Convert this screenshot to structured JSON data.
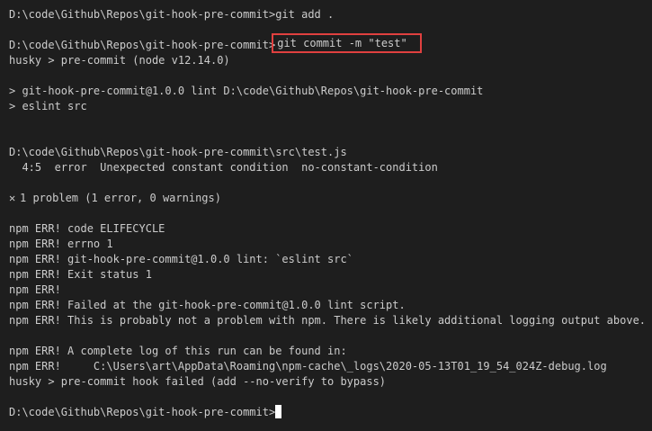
{
  "terminal": {
    "lines": [
      {
        "text": "D:\\code\\Github\\Repos\\git-hook-pre-commit>git add ."
      },
      {
        "text": ""
      },
      {
        "prompt": "D:\\code\\Github\\Repos\\git-hook-pre-commit>",
        "command": "git commit -m \"test\""
      },
      {
        "text": "husky > pre-commit (node v12.14.0)"
      },
      {
        "text": ""
      },
      {
        "text": "> git-hook-pre-commit@1.0.0 lint D:\\code\\Github\\Repos\\git-hook-pre-commit"
      },
      {
        "text": "> eslint src"
      },
      {
        "text": ""
      },
      {
        "text": ""
      },
      {
        "text": "D:\\code\\Github\\Repos\\git-hook-pre-commit\\src\\test.js"
      },
      {
        "text": "  4:5  error  Unexpected constant condition  no-constant-condition"
      },
      {
        "text": ""
      },
      {
        "icon": "✕",
        "text": "1 problem (1 error, 0 warnings)"
      },
      {
        "text": ""
      },
      {
        "text": "npm ERR! code ELIFECYCLE"
      },
      {
        "text": "npm ERR! errno 1"
      },
      {
        "text": "npm ERR! git-hook-pre-commit@1.0.0 lint: `eslint src`"
      },
      {
        "text": "npm ERR! Exit status 1"
      },
      {
        "text": "npm ERR!"
      },
      {
        "text": "npm ERR! Failed at the git-hook-pre-commit@1.0.0 lint script."
      },
      {
        "text": "npm ERR! This is probably not a problem with npm. There is likely additional logging output above."
      },
      {
        "text": ""
      },
      {
        "text": "npm ERR! A complete log of this run can be found in:"
      },
      {
        "text": "npm ERR!     C:\\Users\\art\\AppData\\Roaming\\npm-cache\\_logs\\2020-05-13T01_19_54_024Z-debug.log"
      },
      {
        "text": "husky > pre-commit hook failed (add --no-verify to bypass)"
      },
      {
        "text": ""
      },
      {
        "prompt": "D:\\code\\Github\\Repos\\git-hook-pre-commit>",
        "cursor": true
      }
    ]
  },
  "colors": {
    "background": "#1e1e1e",
    "foreground": "#cccccc",
    "highlight_border": "#e0403f",
    "cursor": "#ffffff"
  }
}
